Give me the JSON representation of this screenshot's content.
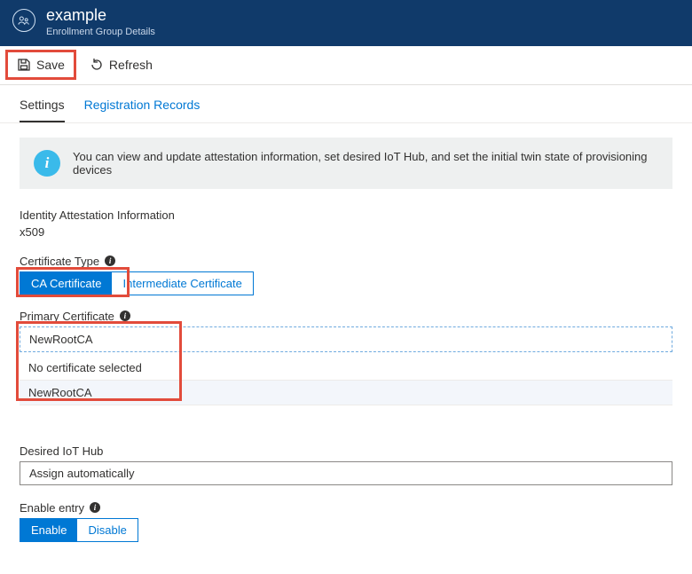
{
  "header": {
    "title": "example",
    "subtitle": "Enrollment Group Details"
  },
  "toolbar": {
    "save_label": "Save",
    "refresh_label": "Refresh"
  },
  "tabs": {
    "settings": "Settings",
    "registration_records": "Registration Records"
  },
  "info_banner": "You can view and update attestation information, set desired IoT Hub, and set the initial twin state of provisioning devices",
  "identity_attestation": {
    "label": "Identity Attestation Information",
    "value": "x509"
  },
  "certificate_type": {
    "label": "Certificate Type",
    "options": {
      "ca": "CA Certificate",
      "intermediate": "Intermediate Certificate"
    }
  },
  "primary_certificate": {
    "label": "Primary Certificate",
    "selected": "NewRootCA",
    "options": [
      "No certificate selected",
      "NewRootCA"
    ]
  },
  "desired_hub": {
    "label": "Desired IoT Hub",
    "value": "Assign automatically"
  },
  "enable_entry": {
    "label": "Enable entry",
    "options": {
      "enable": "Enable",
      "disable": "Disable"
    }
  }
}
